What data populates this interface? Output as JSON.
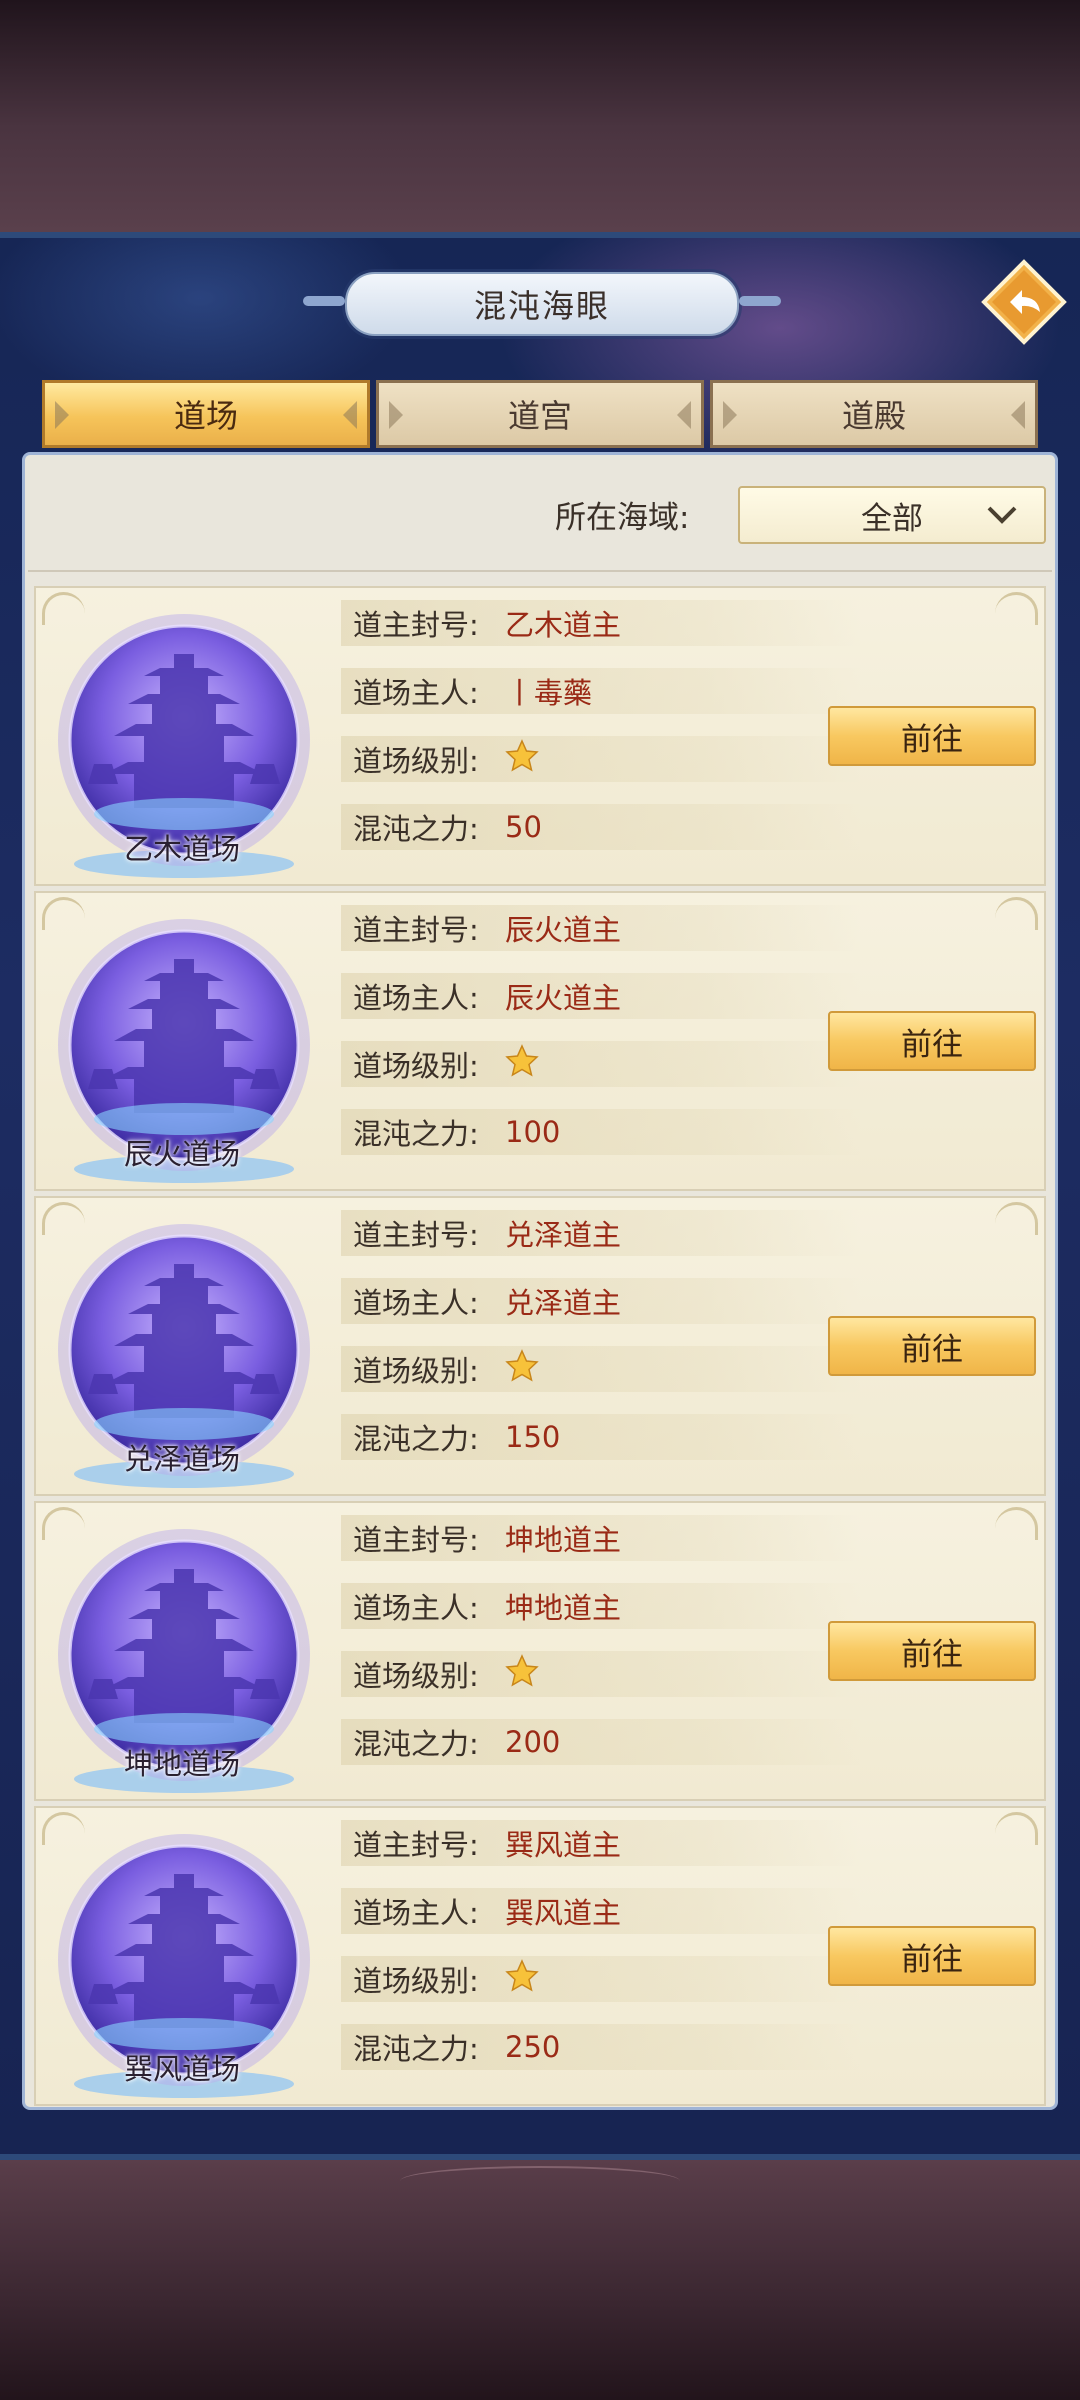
{
  "title": "混沌海眼",
  "tabs": [
    {
      "label": "道场",
      "active": true
    },
    {
      "label": "道宫",
      "active": false
    },
    {
      "label": "道殿",
      "active": false
    }
  ],
  "filter": {
    "label": "所在海域:",
    "value": "全部"
  },
  "field_labels": {
    "title": "道主封号:",
    "owner": "道场主人:",
    "level": "道场级别:",
    "power": "混沌之力:"
  },
  "go_label": "前往",
  "cards": [
    {
      "name": "乙木道场",
      "lord_title": "乙木道主",
      "owner": "丨毒藥",
      "stars": 1,
      "power": "50"
    },
    {
      "name": "辰火道场",
      "lord_title": "辰火道主",
      "owner": "辰火道主",
      "stars": 1,
      "power": "100"
    },
    {
      "name": "兑泽道场",
      "lord_title": "兑泽道主",
      "owner": "兑泽道主",
      "stars": 1,
      "power": "150"
    },
    {
      "name": "坤地道场",
      "lord_title": "坤地道主",
      "owner": "坤地道主",
      "stars": 1,
      "power": "200"
    },
    {
      "name": "巽风道场",
      "lord_title": "巽风道主",
      "owner": "巽风道主",
      "stars": 1,
      "power": "250"
    }
  ],
  "icons": {
    "back": "back-arrow-icon",
    "dropdown": "chevron-down-icon",
    "star": "star-icon"
  },
  "colors": {
    "accent": "#f6c45a",
    "value_text": "#9a2a16",
    "panel": "#e9e6dc"
  }
}
